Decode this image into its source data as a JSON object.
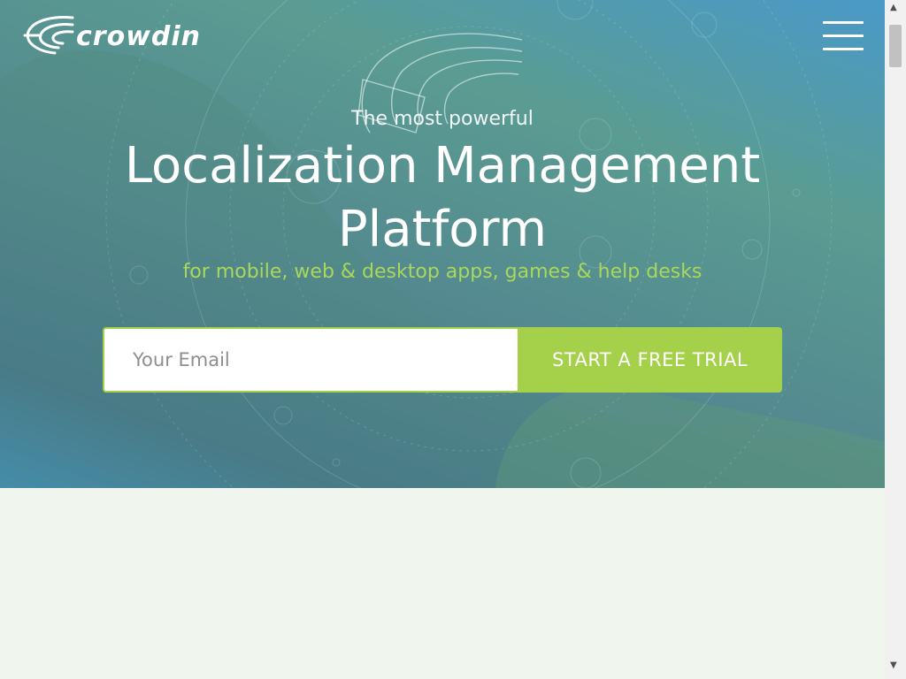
{
  "brand": {
    "name": "crowdin",
    "colors": {
      "accent_green": "#a4d04a",
      "tagline_green": "#a9d85c",
      "hero_teal": "#5a9c92",
      "hero_blue": "#4a9ac9"
    }
  },
  "header": {
    "menu_icon": "hamburger-menu-icon"
  },
  "hero": {
    "subtitle": "The most powerful",
    "headline_line1": "Localization Management",
    "headline_line2": "Platform",
    "tagline": "for mobile, web & desktop apps, games & help desks"
  },
  "signup": {
    "email_placeholder": "Your Email",
    "email_value": "",
    "cta_label": "START A FREE TRIAL"
  },
  "scrollbar": {
    "up_icon": "triangle-up-icon",
    "down_icon": "triangle-down-icon"
  }
}
